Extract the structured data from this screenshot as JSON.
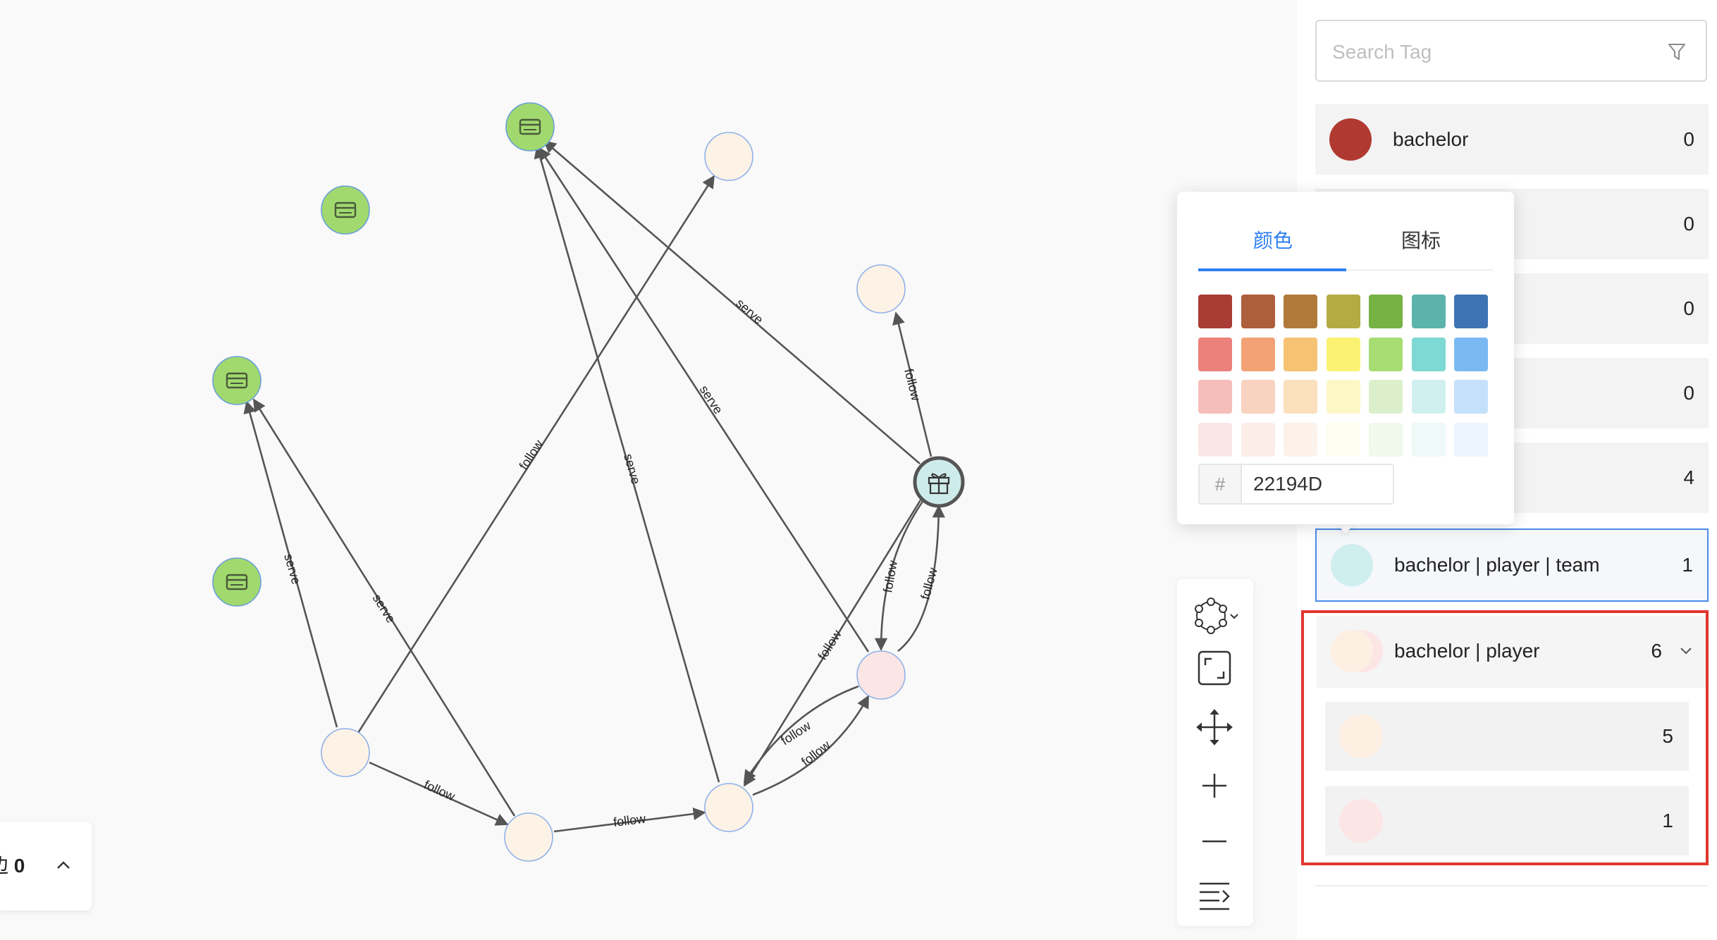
{
  "search": {
    "placeholder": "Search Tag"
  },
  "tags": [
    {
      "label": "bachelor",
      "count": "0",
      "color": "#b03a31"
    },
    {
      "label": "",
      "count": "0"
    },
    {
      "label": "",
      "count": "0"
    },
    {
      "label": "",
      "count": "0"
    },
    {
      "label": "",
      "count": "4"
    },
    {
      "label": "bachelor | player | team",
      "count": "1",
      "color": "#cfeeee"
    },
    {
      "label": "bachelor | player",
      "count": "6",
      "colors": [
        "#fdf0e3",
        "#fce5e5"
      ]
    }
  ],
  "subgroups": [
    {
      "count": "5",
      "color": "#fdf0e3"
    },
    {
      "count": "1",
      "color": "#fce5e5"
    }
  ],
  "color_popover": {
    "tabs": [
      "颜色",
      "图标"
    ],
    "active_tab": "颜色",
    "hex_prefix": "#",
    "hex_value": "22194D",
    "palette": [
      [
        "#a93c34",
        "#ad5e3a",
        "#b07b3a",
        "#b5ab45",
        "#76b244",
        "#5cb3ab",
        "#3e74b3"
      ],
      [
        "#ec817c",
        "#f2a274",
        "#f6c274",
        "#fbf274",
        "#a7dd73",
        "#7ed8d3",
        "#7bb9f2"
      ],
      [
        "#f6bebb",
        "#f8d3bf",
        "#fae0bd",
        "#fcf8c6",
        "#dcefcb",
        "#cff0ef",
        "#c5e0fa"
      ],
      [
        "#fae6e6",
        "#fcede8",
        "#fcf2ea",
        "#fefdf0",
        "#f1f8ec",
        "#eef9f8",
        "#ecf4fd"
      ]
    ]
  },
  "toolbar": {
    "tools": [
      "layout-icon",
      "fit-view-icon",
      "move-icon",
      "zoom-in-icon",
      "zoom-out-icon",
      "expand-icon"
    ]
  },
  "edge_card": {
    "label": "边",
    "count": "0"
  },
  "graph": {
    "node_colors": {
      "card": "#a1d96f",
      "peach": "#fdf2e6",
      "pink": "#fbe5e5",
      "gift": "#cdebea"
    },
    "edge_labels": {
      "serve": "serve",
      "follow": "follow"
    }
  }
}
